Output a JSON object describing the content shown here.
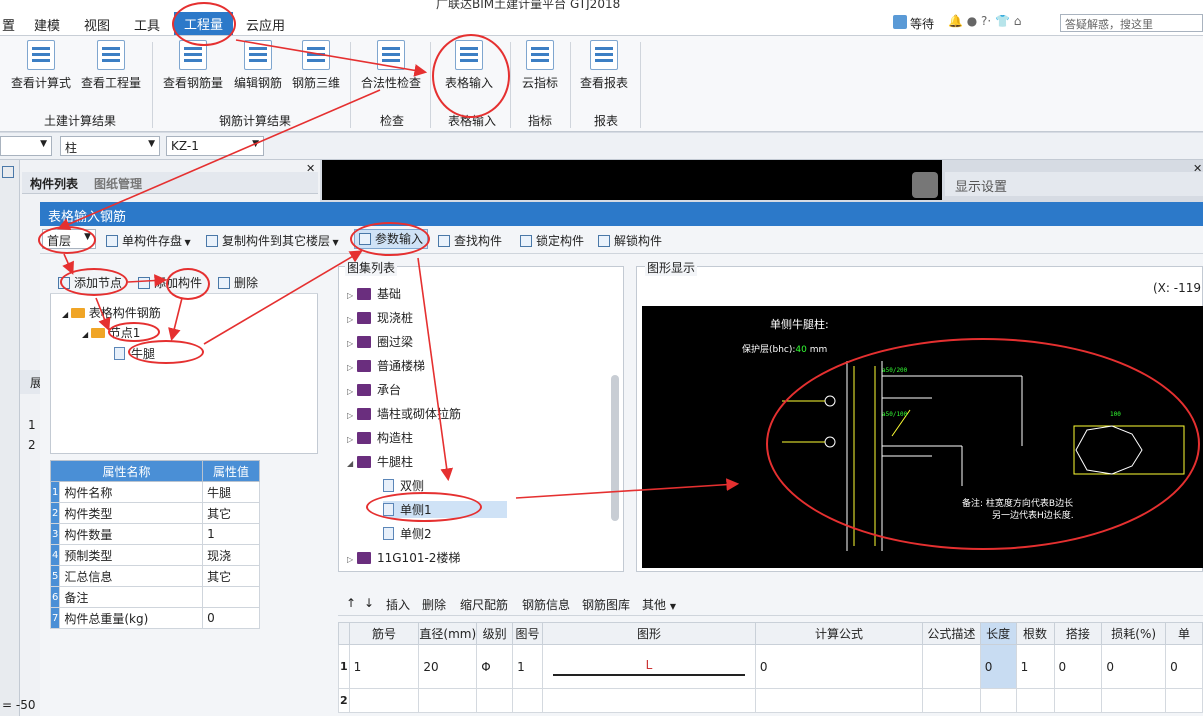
{
  "title": "广联达BIM土建计量平台 GTJ2018",
  "menu": {
    "items": [
      "置",
      "建模",
      "视图",
      "工具",
      "工程量",
      "云应用"
    ],
    "active": "工程量"
  },
  "user": {
    "name": "等待",
    "search_placeholder": "答疑解惑，搜这里"
  },
  "ribbon": {
    "buttons": [
      "查看计算式",
      "查看工程量",
      "查看钢筋量",
      "编辑钢筋",
      "钢筋三维",
      "合法性检查",
      "表格输入",
      "云指标",
      "查看报表"
    ],
    "groups": [
      "土建计算结果",
      "钢筋计算结果",
      "检查",
      "表格输入",
      "指标",
      "报表"
    ]
  },
  "selectors": {
    "type": "柱",
    "name": "KZ-1"
  },
  "panel_tabs": {
    "components": "构件列表",
    "drawings": "图纸管理"
  },
  "display_settings": "显示设置",
  "left_rows": {
    "header": "展",
    "r1": "1",
    "r2": "2",
    "coord": "= -50"
  },
  "dialog": {
    "title": "表格输入钢筋",
    "floor": "首层",
    "toolbar": [
      "单构件存盘",
      "复制构件到其它楼层",
      "参数输入",
      "查找构件",
      "锁定构件",
      "解锁构件"
    ],
    "node_toolbar": [
      "添加节点",
      "添加构件",
      "删除"
    ],
    "tree": {
      "root": "表格构件钢筋",
      "node": "节点1",
      "leaf": "牛腿"
    },
    "props": {
      "header_name": "属性名称",
      "header_value": "属性值",
      "rows": [
        {
          "n": "1",
          "name": "构件名称",
          "value": "牛腿"
        },
        {
          "n": "2",
          "name": "构件类型",
          "value": "其它"
        },
        {
          "n": "3",
          "name": "构件数量",
          "value": "1"
        },
        {
          "n": "4",
          "name": "预制类型",
          "value": "现浇"
        },
        {
          "n": "5",
          "name": "汇总信息",
          "value": "其它"
        },
        {
          "n": "6",
          "name": "备注",
          "value": ""
        },
        {
          "n": "7",
          "name": "构件总重量(kg)",
          "value": "0"
        }
      ]
    },
    "atlas": {
      "title": "图集列表",
      "items": [
        "基础",
        "现浇桩",
        "圈过梁",
        "普通楼梯",
        "承台",
        "墙柱或砌体拉筋",
        "构造柱",
        "牛腿柱"
      ],
      "sub": [
        "双侧",
        "单侧1",
        "单侧2"
      ],
      "last": "11G101-2楼梯"
    },
    "figure": {
      "title": "图形显示",
      "coord": "(X: -119",
      "drawing_title": "单侧牛腿柱:",
      "cover": "保护层(bhc):",
      "cover_val": "40",
      "cover_unit": "mm",
      "note1": "备注: 柱宽度方向代表B边长",
      "note2": "另一边代表H边长度."
    },
    "grid_toolbar": [
      "插入",
      "删除",
      "缩尺配筋",
      "钢筋信息",
      "钢筋图库",
      "其他"
    ],
    "grid_headers": [
      "筋号",
      "直径(mm)",
      "级别",
      "图号",
      "图形",
      "计算公式",
      "公式描述",
      "长度",
      "根数",
      "搭接",
      "损耗(%)",
      "单"
    ],
    "rows": [
      {
        "n": "1",
        "id": "1",
        "dia": "20",
        "grade": "Φ",
        "fig": "1",
        "shape": "L",
        "formula": "0",
        "desc": "",
        "len": "0",
        "count": "1",
        "lap": "0",
        "loss": "0",
        "unit": "0"
      },
      {
        "n": "2"
      }
    ]
  }
}
